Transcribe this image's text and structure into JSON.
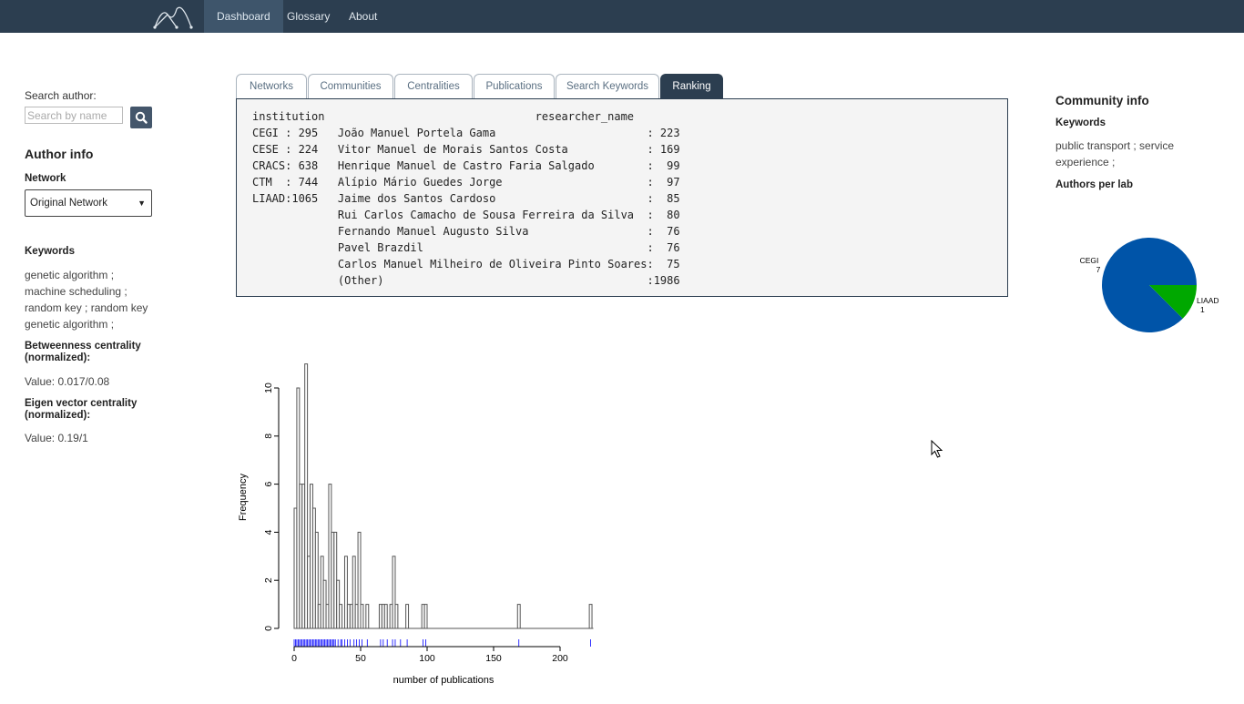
{
  "nav": {
    "items": [
      {
        "label": "Dashboard",
        "active": true
      },
      {
        "label": "Glossary",
        "active": false
      },
      {
        "label": "About",
        "active": false
      }
    ]
  },
  "left": {
    "search_label": "Search author:",
    "search_placeholder": "Search by name",
    "author_info_title": "Author info",
    "network_label": "Network",
    "network_selected": "Original Network",
    "keywords_label": "Keywords",
    "keywords_lines": [
      "genetic algorithm ;",
      "machine scheduling ;",
      "random key ; random key",
      "genetic algorithm ;"
    ],
    "betweenness_label_1": "Betweenness centrality",
    "betweenness_label_2": "(normalized):",
    "betweenness_value": "Value: 0.017/0.08",
    "eigen_label_1": "Eigen vector centrality",
    "eigen_label_2": "(normalized):",
    "eigen_value": "Value: 0.19/1"
  },
  "tabs": [
    {
      "label": "Networks",
      "active": false
    },
    {
      "label": "Communities",
      "active": false
    },
    {
      "label": "Centralities",
      "active": false
    },
    {
      "label": "Publications",
      "active": false
    },
    {
      "label": "Search Keywords",
      "active": false
    },
    {
      "label": "Ranking",
      "active": true
    }
  ],
  "ranking": {
    "lines": [
      "institution                                researcher_name",
      "CEGI : 295   João Manuel Portela Gama                       : 223",
      "CESE : 224   Vitor Manuel de Morais Santos Costa            : 169",
      "CRACS: 638   Henrique Manuel de Castro Faria Salgado        :  99",
      "CTM  : 744   Alípio Mário Guedes Jorge                      :  97",
      "LIAAD:1065   Jaime dos Santos Cardoso                       :  85",
      "             Rui Carlos Camacho de Sousa Ferreira da Silva  :  80",
      "             Fernando Manuel Augusto Silva                  :  76",
      "             Pavel Brazdil                                  :  76",
      "             Carlos Manuel Milheiro de Oliveira Pinto Soares:  75",
      "             (Other)                                        :1986"
    ]
  },
  "chart_data": [
    {
      "type": "bar",
      "subtype": "histogram",
      "title": "",
      "xlabel": "number of publications",
      "ylabel": "Frequency",
      "xlim": [
        0,
        225
      ],
      "ylim": [
        0,
        11
      ],
      "xticks": [
        0,
        50,
        100,
        150,
        200
      ],
      "yticks": [
        0,
        2,
        4,
        6,
        8,
        10
      ],
      "bin_width": 2,
      "bins_start": [
        0,
        2,
        4,
        6,
        8,
        10,
        12,
        14,
        16,
        18,
        20,
        22,
        24,
        26,
        28,
        30,
        32,
        34,
        38,
        40,
        42,
        44,
        46,
        48,
        50,
        54,
        64,
        66,
        68,
        72,
        74,
        76,
        84,
        96,
        98,
        168,
        222
      ],
      "values": [
        5,
        10,
        6,
        6,
        11,
        3,
        6,
        5,
        4,
        1,
        3,
        2,
        1,
        6,
        4,
        4,
        2,
        1,
        3,
        1,
        1,
        3,
        1,
        4,
        1,
        1,
        1,
        1,
        1,
        1,
        3,
        1,
        1,
        1,
        1,
        1,
        1
      ],
      "rug_color": "#0000ff",
      "rug": [
        0,
        1,
        2,
        3,
        4,
        5,
        6,
        7,
        8,
        9,
        10,
        11,
        12,
        13,
        14,
        15,
        16,
        17,
        18,
        19,
        20,
        21,
        22,
        23,
        24,
        25,
        26,
        27,
        28,
        29,
        30,
        31,
        33,
        35,
        36,
        38,
        40,
        42,
        45,
        47,
        49,
        51,
        55,
        65,
        67,
        70,
        74,
        76,
        80,
        85,
        97,
        99,
        169,
        223
      ]
    },
    {
      "type": "pie",
      "title": "Authors per lab",
      "slices": [
        {
          "label": "CEGI",
          "value": 7,
          "color": "#0054a8"
        },
        {
          "label": "LIAAD",
          "value": 1,
          "color": "#00a800"
        }
      ]
    }
  ],
  "right": {
    "community_title": "Community info",
    "keywords_label": "Keywords",
    "keywords_lines": [
      "public transport ; service",
      "experience ;"
    ],
    "authors_per_lab_label": "Authors per lab"
  }
}
